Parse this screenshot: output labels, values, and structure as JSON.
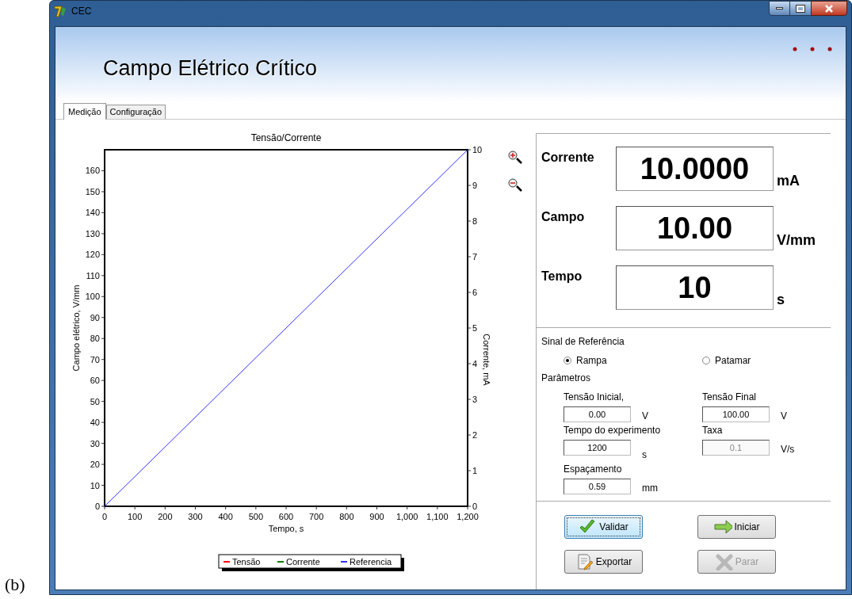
{
  "figure_label": "(b)",
  "window": {
    "title": "CEC"
  },
  "header": {
    "title": "Campo Elétrico Crítico"
  },
  "tabs": [
    {
      "label": "Medição",
      "selected": true
    },
    {
      "label": "Configuração",
      "selected": false
    }
  ],
  "chart": {
    "chart_data": {
      "type": "line",
      "title": "Tensão/Corrente",
      "xlabel": "Tempo, s",
      "ylabel": "Campo elétrico, V/mm",
      "y2label": "Corrente, mA",
      "x": [
        0,
        1200
      ],
      "series": [
        {
          "name": "Tensão",
          "color": "#ff0000",
          "values": [
            null,
            null
          ]
        },
        {
          "name": "Corrente",
          "color": "#008000",
          "values": [
            null,
            null
          ]
        },
        {
          "name": "Referencia",
          "color": "#3333ff",
          "values": [
            0,
            170
          ]
        }
      ],
      "xlim": [
        0,
        1200
      ],
      "ylim": [
        0,
        170
      ],
      "y2lim": [
        0,
        10
      ],
      "xticks": [
        {
          "value": 0,
          "label": "0"
        },
        {
          "value": 100,
          "label": "100"
        },
        {
          "value": 200,
          "label": "200"
        },
        {
          "value": 300,
          "label": "300"
        },
        {
          "value": 400,
          "label": "400"
        },
        {
          "value": 500,
          "label": "500"
        },
        {
          "value": 600,
          "label": "600"
        },
        {
          "value": 700,
          "label": "700"
        },
        {
          "value": 800,
          "label": "800"
        },
        {
          "value": 900,
          "label": "900"
        },
        {
          "value": 1000,
          "label": "1,000"
        },
        {
          "value": 1100,
          "label": "1,100"
        },
        {
          "value": 1200,
          "label": "1,200"
        }
      ],
      "yticks": [
        0,
        10,
        20,
        30,
        40,
        50,
        60,
        70,
        80,
        90,
        100,
        110,
        120,
        130,
        140,
        150,
        160
      ],
      "y2ticks": [
        0,
        1,
        2,
        3,
        4,
        5,
        6,
        7,
        8,
        9,
        10
      ]
    }
  },
  "readouts": [
    {
      "label": "Corrente",
      "value": "10.0000",
      "unit": "mA"
    },
    {
      "label": "Campo",
      "value": "10.00",
      "unit": "V/mm"
    },
    {
      "label": "Tempo",
      "value": "10",
      "unit": "s"
    }
  ],
  "reference": {
    "title": "Sinal de Referência",
    "options": [
      {
        "label": "Rampa",
        "selected": true
      },
      {
        "label": "Patamar",
        "selected": false
      }
    ]
  },
  "parameters": {
    "title": "Parâmetros",
    "fields": [
      {
        "label": "Tensão Inicial,",
        "value": "0.00",
        "unit": "V",
        "disabled": false
      },
      {
        "label": "Tensão Final",
        "value": "100.00",
        "unit": "V",
        "disabled": false
      },
      {
        "label": "Tempo do experimento",
        "value": "1200",
        "unit": "s",
        "disabled": false
      },
      {
        "label": "Taxa",
        "value": "0.1",
        "unit": "V/s",
        "disabled": true
      },
      {
        "label": "Espaçamento",
        "value": "0.59",
        "unit": "mm",
        "disabled": false
      }
    ]
  },
  "buttons": [
    {
      "label": "Validar",
      "kind": "check",
      "disabled": false,
      "focused": true
    },
    {
      "label": "Iniciar",
      "kind": "arrow",
      "disabled": false,
      "focused": false
    },
    {
      "label": "Exportar",
      "kind": "document",
      "disabled": false,
      "focused": false
    },
    {
      "label": "Parar",
      "kind": "cross",
      "disabled": true,
      "focused": false
    }
  ]
}
